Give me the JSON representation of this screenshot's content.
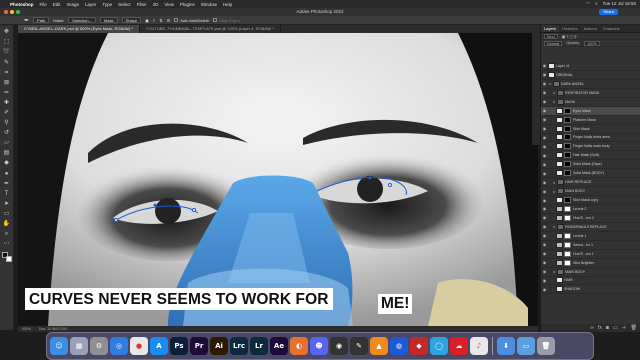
{
  "menubar": {
    "app_name": "Photoshop",
    "items": [
      "File",
      "Edit",
      "Image",
      "Layer",
      "Type",
      "Select",
      "Filter",
      "3D",
      "View",
      "Plugins",
      "Window",
      "Help"
    ],
    "clock": "Tue 12 Jul 18:50"
  },
  "titlebar": {
    "title": "Adobe Photoshop 2022",
    "share_label": "Share"
  },
  "options_bar": {
    "path_mode": "Path",
    "make_label": "Make:",
    "selection_button": "Selection...",
    "mask_button": "Mask",
    "shape_button": "Shape",
    "auto_add_delete": "Auto Add/Delete",
    "align_edges": "Align Edges"
  },
  "tabs": [
    {
      "label": "CY8EB–ANGEL–DARK.psd @ 600% (Eyes Mask, RGB/8#) *"
    },
    {
      "label": "YOUTUBE–THUMBNAIL–TEMPLATE.psd @ 100% (Layer 4, RGB/8#) *"
    }
  ],
  "tools": [
    "move-icon",
    "marquee-icon",
    "lasso-icon",
    "quick-select-icon",
    "crop-icon",
    "frame-icon",
    "eyedropper-icon",
    "healing-icon",
    "brush-icon",
    "stamp-icon",
    "history-brush-icon",
    "eraser-icon",
    "gradient-icon",
    "blur-icon",
    "dodge-icon",
    "pen-icon",
    "type-icon",
    "path-select-icon",
    "shape-icon",
    "hand-icon",
    "zoom-icon",
    "more-tools-icon"
  ],
  "canvas": {
    "caption_main": "CURVES NEVER SEEMS TO WORK FOR",
    "caption_end": "ME!"
  },
  "status": {
    "zoom": "600%",
    "doc": "Doc: 10.5M/2.00G"
  },
  "panel": {
    "tabs": [
      "Layers",
      "Histories",
      "Actions",
      "Channels"
    ],
    "kind_label": "Kind",
    "blend_mode": "Normal",
    "opacity_label": "Opacity:",
    "opacity_value": "100%",
    "lock_label": "Lock:",
    "fill_label": "Fill:",
    "fill_value": "100%",
    "layers": [
      {
        "name": "Layer 11",
        "type": "thumb",
        "indent": 0
      },
      {
        "name": "ORIGINAL",
        "type": "thumb",
        "indent": 0
      },
      {
        "name": "DARK ANGEL",
        "type": "group",
        "indent": 0
      },
      {
        "name": "RESPIRATOR MASK",
        "type": "group",
        "indent": 1
      },
      {
        "name": "MASK",
        "type": "group",
        "indent": 1
      },
      {
        "name": "Eyes Mask",
        "type": "mask",
        "indent": 2,
        "selected": true
      },
      {
        "name": "Platform Mask",
        "type": "mask",
        "indent": 2
      },
      {
        "name": "Skin Mask",
        "type": "mask",
        "indent": 2
      },
      {
        "name": "Finger Nails extra arms",
        "type": "mask",
        "indent": 2
      },
      {
        "name": "Finger Nails main body",
        "type": "mask",
        "indent": 2
      },
      {
        "name": "Hair Mask (Soft)",
        "type": "mask",
        "indent": 2
      },
      {
        "name": "Solid Mask (Tape)",
        "type": "mask",
        "indent": 2
      },
      {
        "name": "Solid Mask (BODY)",
        "type": "mask",
        "indent": 2
      },
      {
        "name": "HAIR REPLACE",
        "type": "group",
        "indent": 1
      },
      {
        "name": "MAIN BODY",
        "type": "group",
        "indent": 1
      },
      {
        "name": "Skin Mask copy",
        "type": "mask",
        "indent": 2
      },
      {
        "name": "Levels 2",
        "type": "adjust",
        "indent": 2
      },
      {
        "name": "Hue/S...ion 2",
        "type": "adjust",
        "indent": 2
      },
      {
        "name": "FINGERNAILS REPLACE",
        "type": "group",
        "indent": 1
      },
      {
        "name": "Levels 1",
        "type": "adjust",
        "indent": 2
      },
      {
        "name": "Select...lor 1",
        "type": "adjust",
        "indent": 2
      },
      {
        "name": "Hue/S...ion 1",
        "type": "adjust",
        "indent": 2
      },
      {
        "name": "Skin Brighten",
        "type": "adjust",
        "indent": 2
      },
      {
        "name": "MAIN BODY",
        "type": "group",
        "indent": 1
      },
      {
        "name": "HAIR",
        "type": "thumb",
        "indent": 2
      },
      {
        "name": "SHADOW",
        "type": "thumb",
        "indent": 2
      }
    ]
  },
  "dock": [
    {
      "name": "finder",
      "label": "☺",
      "color": "#3a8ee6"
    },
    {
      "name": "launchpad",
      "label": "▦",
      "color": "#9aa0b8"
    },
    {
      "name": "settings",
      "label": "⚙",
      "color": "#8e8e93"
    },
    {
      "name": "safari",
      "label": "◎",
      "color": "#2f7de1"
    },
    {
      "name": "chrome",
      "label": "●",
      "color": "#e8e8e8"
    },
    {
      "name": "app-store",
      "label": "A",
      "color": "#1a8cf0"
    },
    {
      "name": "photoshop",
      "label": "Ps",
      "color": "#0b1e3a"
    },
    {
      "name": "premiere",
      "label": "Pr",
      "color": "#1f0b3a"
    },
    {
      "name": "illustrator",
      "label": "Ai",
      "color": "#2d1a00"
    },
    {
      "name": "lightroom-classic",
      "label": "Lrc",
      "color": "#0b2a3e"
    },
    {
      "name": "lightroom",
      "label": "Lr",
      "color": "#0b2a3e"
    },
    {
      "name": "after-effects",
      "label": "Ae",
      "color": "#1c0b3a"
    },
    {
      "name": "firefox",
      "label": "◐",
      "color": "#e8702a"
    },
    {
      "name": "discord",
      "label": "☻",
      "color": "#5865f2"
    },
    {
      "name": "obs",
      "label": "◉",
      "color": "#333333"
    },
    {
      "name": "notes",
      "label": "✎",
      "color": "#333333"
    },
    {
      "name": "vlc",
      "label": "▲",
      "color": "#f08a1c"
    },
    {
      "name": "vpn",
      "label": "◍",
      "color": "#1c5ad8"
    },
    {
      "name": "pdf-app",
      "label": "◆",
      "color": "#c62828"
    },
    {
      "name": "globe-app",
      "label": "◯",
      "color": "#2ca5e0"
    },
    {
      "name": "creative-cloud",
      "label": "☁",
      "color": "#da1f26"
    },
    {
      "name": "music",
      "label": "♪",
      "color": "#e8e8e8"
    },
    {
      "name": "downloads",
      "label": "⬇",
      "color": "#4a90e2"
    },
    {
      "name": "folder",
      "label": "▭",
      "color": "#5aa0e0"
    },
    {
      "name": "trash",
      "label": "🗑",
      "color": "#9a9aa8"
    }
  ]
}
